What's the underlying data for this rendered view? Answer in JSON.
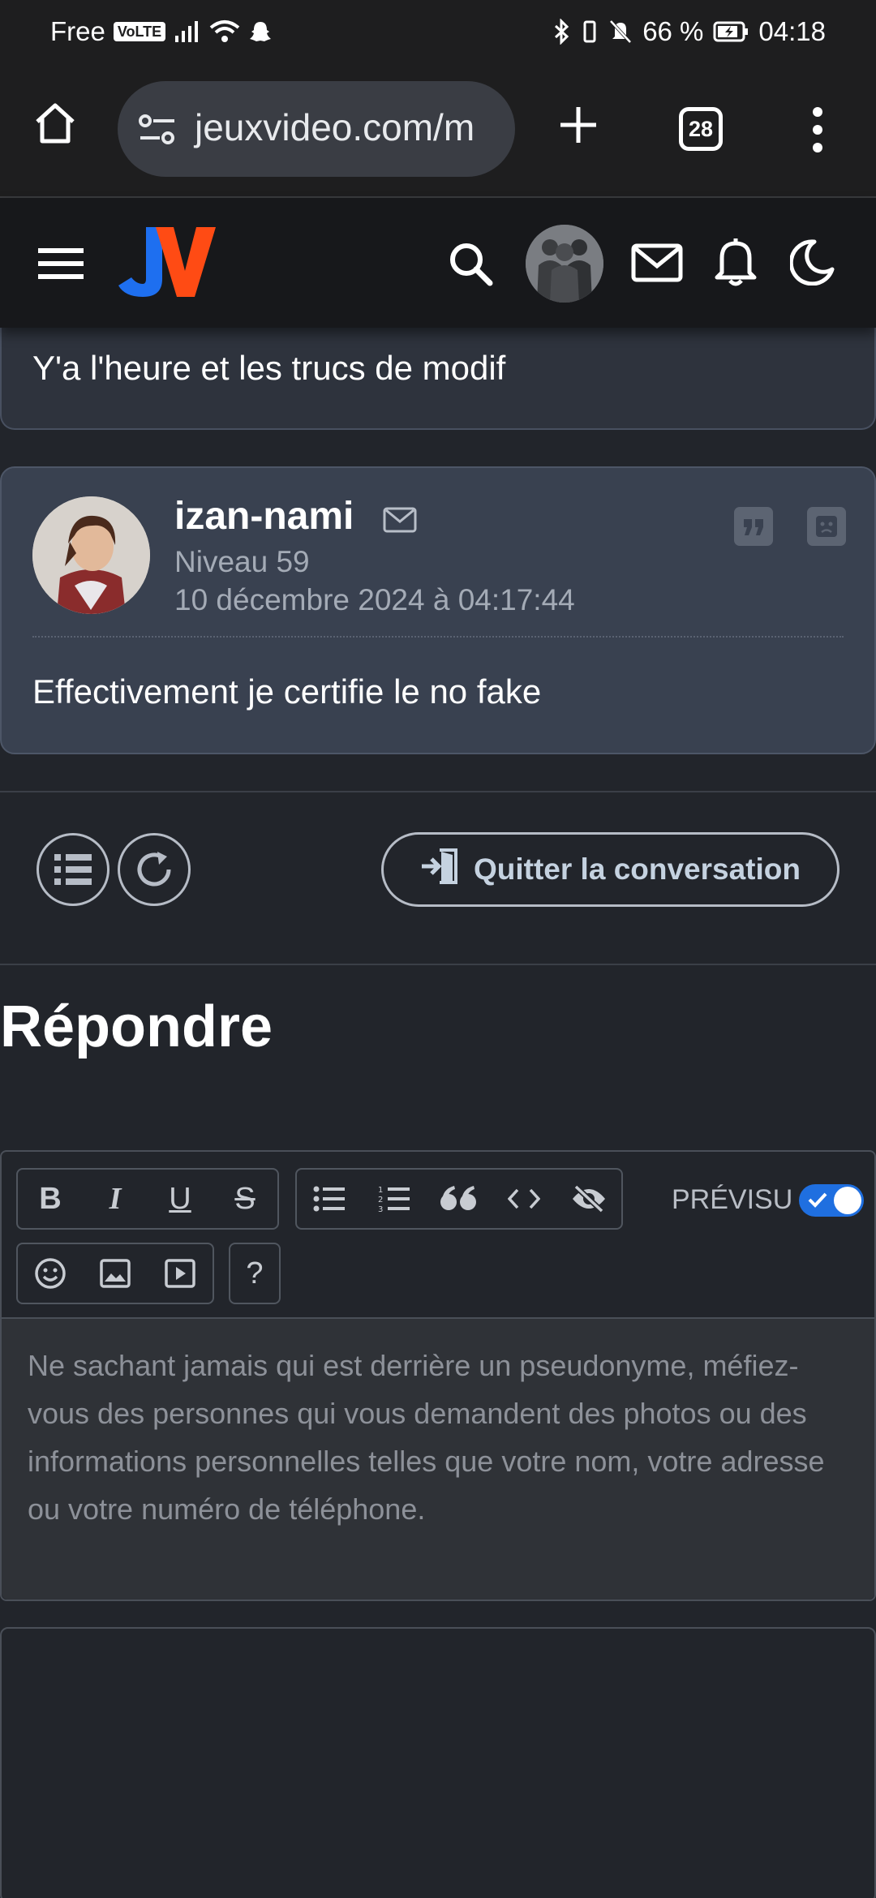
{
  "status_bar": {
    "carrier": "Free",
    "volte": "VoLTE",
    "battery": "66 %",
    "time": "04:18"
  },
  "browser": {
    "url": "jeuxvideo.com/m",
    "tab_count": "28"
  },
  "site": {
    "logo": "JV"
  },
  "previous_post": {
    "text": "Y'a l'heure et les trucs de modif"
  },
  "post": {
    "author": "izan-nami",
    "level": "Niveau 59",
    "date": "10 décembre 2024 à 04:17:44",
    "text": "Effectivement je certifie le no fake"
  },
  "actions": {
    "quit_label": "Quitter la conversation"
  },
  "reply": {
    "title": "Répondre",
    "preview_label": "PRÉVISU",
    "preview_enabled": true,
    "help_label": "?",
    "placeholder": "Ne sachant jamais qui est derrière un pseudonyme, méfiez-vous des personnes qui vous demandent des photos ou des informations personnelles telles que votre nom, votre adresse ou votre numéro de téléphone.",
    "toolbar": {
      "bold": "B",
      "italic": "I",
      "underline": "U",
      "strike": "S"
    }
  },
  "colors": {
    "accent_blue": "#1f6fe0",
    "logo_orange": "#ff4b14",
    "logo_blue": "#1e6ff0",
    "post_bg": "#394150"
  }
}
